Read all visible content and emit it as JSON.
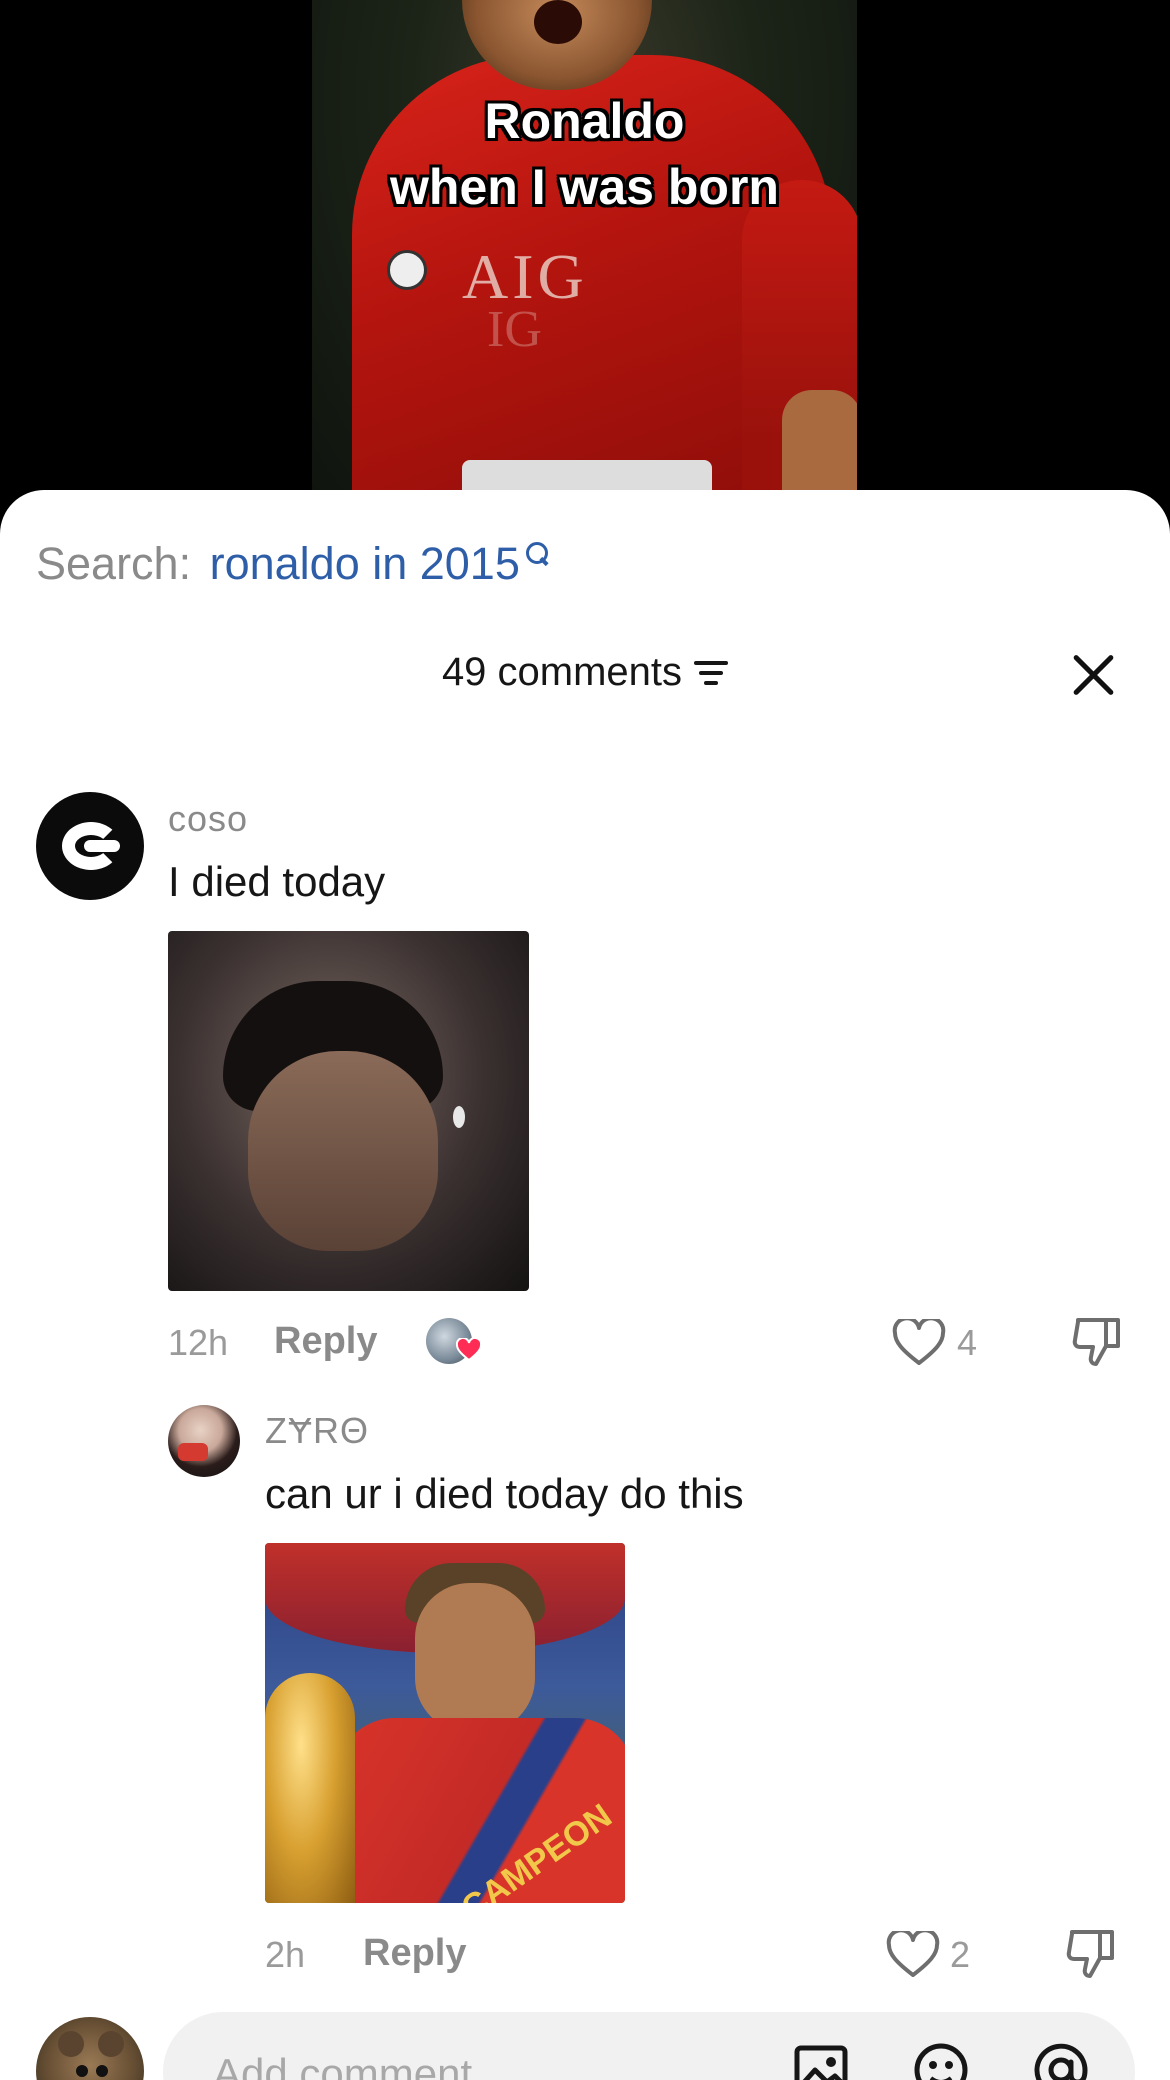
{
  "video": {
    "overlay_text_line1": "Ronaldo",
    "overlay_text_line2": "when I was born",
    "shirt_text": "AIG",
    "shirt_text_2": "IG"
  },
  "search": {
    "prefix": "Search:",
    "query": "ronaldo in 2015"
  },
  "comments_header": {
    "count_label": "49 comments"
  },
  "comments": [
    {
      "username": "coso",
      "text": "I died today",
      "time": "12h",
      "reply_label": "Reply",
      "likes": "4"
    },
    {
      "username": "ZɎRΘ",
      "text": "can ur i died today do this",
      "time": "2h",
      "reply_label": "Reply",
      "likes": "2",
      "image_caption_text": "CAMPEON"
    }
  ],
  "composer": {
    "placeholder": "Add comment..."
  },
  "colors": {
    "accent_link": "#2f5ea8",
    "like_heart": "#ff2d55"
  }
}
